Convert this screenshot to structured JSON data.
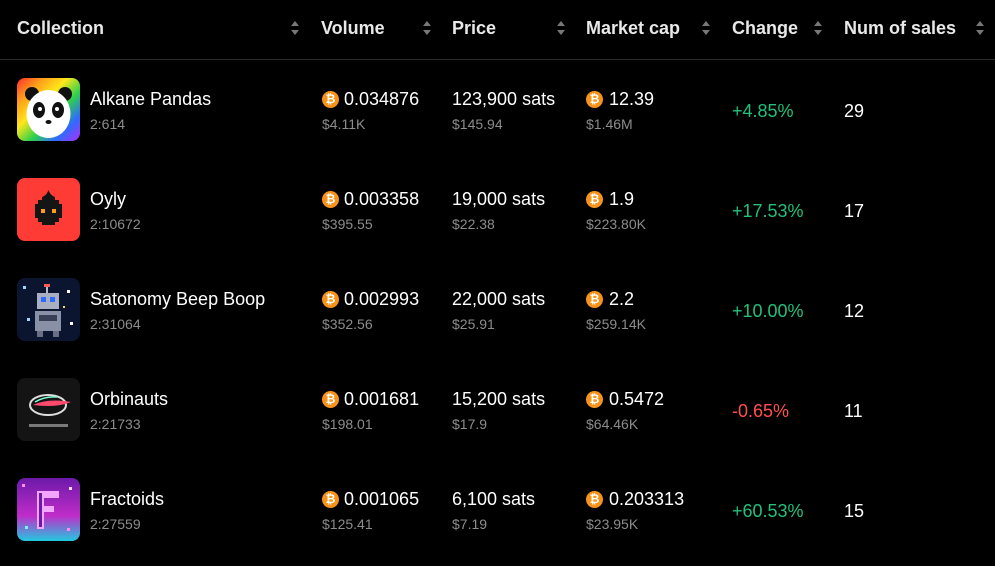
{
  "header": {
    "collection": "Collection",
    "volume": "Volume",
    "price": "Price",
    "market_cap": "Market cap",
    "change": "Change",
    "num_sales": "Num of sales"
  },
  "coin_symbol": "₿",
  "colors": {
    "positive": "#21c07a",
    "negative": "#ff4f4f",
    "coin": "#f7931a"
  },
  "rows": [
    {
      "name": "Alkane Pandas",
      "id": "2:614",
      "volume_btc": "0.034876",
      "volume_usd": "$4.11K",
      "price_sats": "123,900 sats",
      "price_usd": "$145.94",
      "mcap_btc": "12.39",
      "mcap_usd": "$1.46M",
      "change": "+4.85%",
      "sales": "29",
      "icon": "panda-icon"
    },
    {
      "name": "Oyly",
      "id": "2:10672",
      "volume_btc": "0.003358",
      "volume_usd": "$395.55",
      "price_sats": "19,000 sats",
      "price_usd": "$22.38",
      "mcap_btc": "1.9",
      "mcap_usd": "$223.80K",
      "change": "+17.53%",
      "sales": "17",
      "icon": "oil-drop-icon"
    },
    {
      "name": "Satonomy Beep Boop",
      "id": "2:31064",
      "volume_btc": "0.002993",
      "volume_usd": "$352.56",
      "price_sats": "22,000 sats",
      "price_usd": "$25.91",
      "mcap_btc": "2.2",
      "mcap_usd": "$259.14K",
      "change": "+10.00%",
      "sales": "12",
      "icon": "robot-icon"
    },
    {
      "name": "Orbinauts",
      "id": "2:21733",
      "volume_btc": "0.001681",
      "volume_usd": "$198.01",
      "price_sats": "15,200 sats",
      "price_usd": "$17.9",
      "mcap_btc": "0.5472",
      "mcap_usd": "$64.46K",
      "change": "-0.65%",
      "sales": "11",
      "icon": "orb-icon"
    },
    {
      "name": "Fractoids",
      "id": "2:27559",
      "volume_btc": "0.001065",
      "volume_usd": "$125.41",
      "price_sats": "6,100 sats",
      "price_usd": "$7.19",
      "mcap_btc": "0.203313",
      "mcap_usd": "$23.95K",
      "change": "+60.53%",
      "sales": "15",
      "icon": "letter-f-icon"
    }
  ]
}
